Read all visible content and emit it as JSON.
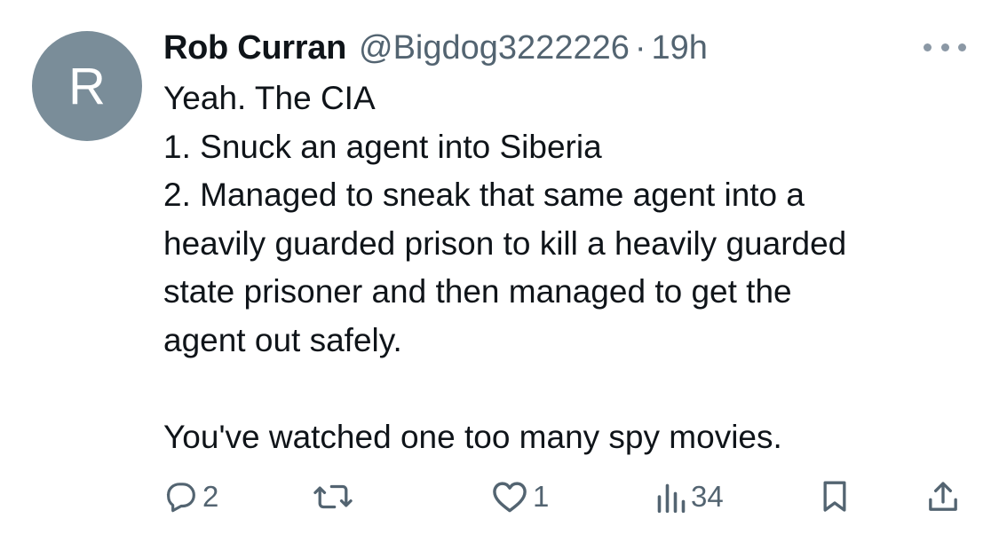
{
  "author": {
    "avatar_letter": "R",
    "display_name": "Rob Curran",
    "handle": "@Bigdog3222226",
    "separator": "·",
    "time": "19h"
  },
  "tweet": {
    "lines": [
      "Yeah. The CIA",
      "1. Snuck an agent into Siberia",
      "2. Managed to sneak that same agent into a",
      "heavily guarded prison to kill a heavily guarded",
      "state prisoner and then managed to get the",
      "agent out safely.",
      "",
      "You've watched one too many spy movies."
    ]
  },
  "actions": {
    "reply": {
      "icon": "reply-icon",
      "count": "2"
    },
    "retweet": {
      "icon": "retweet-icon",
      "count": ""
    },
    "like": {
      "icon": "heart-icon",
      "count": "1"
    },
    "views": {
      "icon": "views-icon",
      "count": "34"
    },
    "bookmark": {
      "icon": "bookmark-icon"
    },
    "share": {
      "icon": "share-icon"
    }
  },
  "colors": {
    "avatar_bg": "#7a8d99",
    "text": "#0f1419",
    "secondary": "#536471"
  }
}
